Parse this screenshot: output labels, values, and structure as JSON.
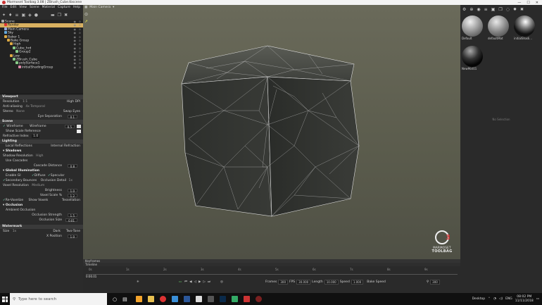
{
  "window": {
    "title": "Marmoset Toolbag 3.08 | ZBrush_Cube.tbscene",
    "controls": [
      "—",
      "☐",
      "✕"
    ]
  },
  "menu": [
    "File",
    "Edit",
    "View",
    "Scene",
    "Material",
    "Capture",
    "Help"
  ],
  "outliner": [
    {
      "label": "Scene",
      "indent": 0,
      "sel": false,
      "color": "#aaa"
    },
    {
      "label": "Render",
      "indent": 1,
      "sel": true,
      "color": "#d33"
    },
    {
      "label": "Main Camera",
      "indent": 1,
      "sel": false,
      "color": "#9ad"
    },
    {
      "label": "Sky",
      "indent": 1,
      "sel": false,
      "color": "#6ad"
    },
    {
      "label": "Baker 1",
      "indent": 1,
      "sel": false,
      "color": "#da4"
    },
    {
      "label": "Bake Group",
      "indent": 2,
      "sel": false,
      "color": "#da4"
    },
    {
      "label": "High",
      "indent": 3,
      "sel": false,
      "color": "#da4"
    },
    {
      "label": "Cube_hrd",
      "indent": 4,
      "sel": false,
      "color": "#8c8"
    },
    {
      "label": "Group2",
      "indent": 5,
      "sel": false,
      "color": "#8c8"
    },
    {
      "label": "Low",
      "indent": 3,
      "sel": false,
      "color": "#da4"
    },
    {
      "label": "ZBrush_Cube",
      "indent": 4,
      "sel": false,
      "color": "#8c8"
    },
    {
      "label": "polySurface1",
      "indent": 5,
      "sel": false,
      "color": "#8c8"
    },
    {
      "label": "initialShadingGroup",
      "indent": 6,
      "sel": false,
      "color": "#d8a"
    }
  ],
  "props": {
    "viewport": {
      "header": "Viewport",
      "resolution_label": "Resolution",
      "resolution_value": "1:1",
      "high_dpi": "High DPI",
      "antialias_label": "Anti-aliasing",
      "antialias_value": "4x Temporal",
      "stereo_label": "Stereo",
      "stereo_value": "None",
      "swap_eyes": "Swap Eyes",
      "eye_sep_label": "Eye Separation",
      "eye_sep_value": "0.1"
    },
    "scene": {
      "header": "Scene",
      "wireframe": "Wireframe",
      "wireframe_label": "Wireframe",
      "wireframe_value": "0.5",
      "show_scale": "Show Scale Reference",
      "refr_label": "Refractive Index",
      "refr_value": "1.0"
    },
    "lighting": {
      "header": "Lighting",
      "local_reflections": "Local Reflections",
      "internal_refraction": "Internal Refraction",
      "shadows_header": "Shadows",
      "shadow_res_label": "Shadow Resolution",
      "shadow_res_value": "High",
      "use_cascades": "Use Cascades",
      "cascade_label": "Cascade Distance",
      "cascade_value": "0.8",
      "gi_header": "Global Illumination",
      "enable_gi": "Enable GI",
      "diffuse": "Diffuse",
      "specular": "Specular",
      "secondary": "Secondary Bounces",
      "occlusion_detail": "Occlusion Detail",
      "occlusion_detail_value": "1x",
      "voxel_res_label": "Voxel Resolution",
      "voxel_res_value": "Medium",
      "brightness_label": "Brightness",
      "brightness_value": "1.0",
      "voxel_scale_label": "Voxel Scale %",
      "voxel_scale_value": "1.2",
      "revoxelize": "Re-Voxelize",
      "show_voxels": "Show Voxels",
      "tessellation": "Tessellation",
      "occlusion_header": "Occlusion",
      "ambient_occ": "Ambient Occlusion",
      "occ_strength_label": "Occlusion Strength",
      "occ_strength_value": "1.5",
      "occ_size_label": "Occlusion Size",
      "occ_size_value": "0.01"
    },
    "watermark": {
      "header": "Watermark",
      "size_label": "Size",
      "size_value": "1x",
      "dark": "Dark",
      "two_tone": "Two-Tone",
      "xpos_label": "X Position",
      "xpos_value": "1.0"
    }
  },
  "viewport": {
    "camera_label": "Main Camera"
  },
  "logo": {
    "line1": "MARMOSET",
    "line2": "TOOLBAG",
    "num": "3"
  },
  "materials": [
    {
      "label": "Default",
      "color1": "#e8e8e8",
      "color2": "#606060"
    },
    {
      "label": "defaultMat",
      "color1": "#dcdcdc",
      "color2": "#5a5a5a"
    },
    {
      "label": "initialShadi...",
      "color1": "#f0f0f0",
      "color2": "#1a1a1a"
    },
    {
      "label": "NewMat01",
      "color1": "#888888",
      "color2": "#0a0a0a"
    }
  ],
  "no_selection": "No Selection",
  "timeline": {
    "keyframes_label": "Keyframes",
    "timeline_label": "Timeline",
    "current_time": "0:00.01",
    "ticks": [
      "0s",
      "1s",
      "2s",
      "3s",
      "4s",
      "5s",
      "6s",
      "7s",
      "8s",
      "9s"
    ],
    "frames_label": "Frames",
    "frames_value": "300",
    "fps_label": "FPS",
    "fps_value": "30.000",
    "length_label": "Length",
    "length_value": "10.000",
    "speed_label": "Speed",
    "speed_value": "1.000",
    "bake_speed": "Bake Speed",
    "end_value": "300"
  },
  "taskbar": {
    "search_placeholder": "Type here to search",
    "desktop": "Desktop",
    "lang": "ENG",
    "time": "08:02 PM",
    "date": "11/11/2018"
  }
}
